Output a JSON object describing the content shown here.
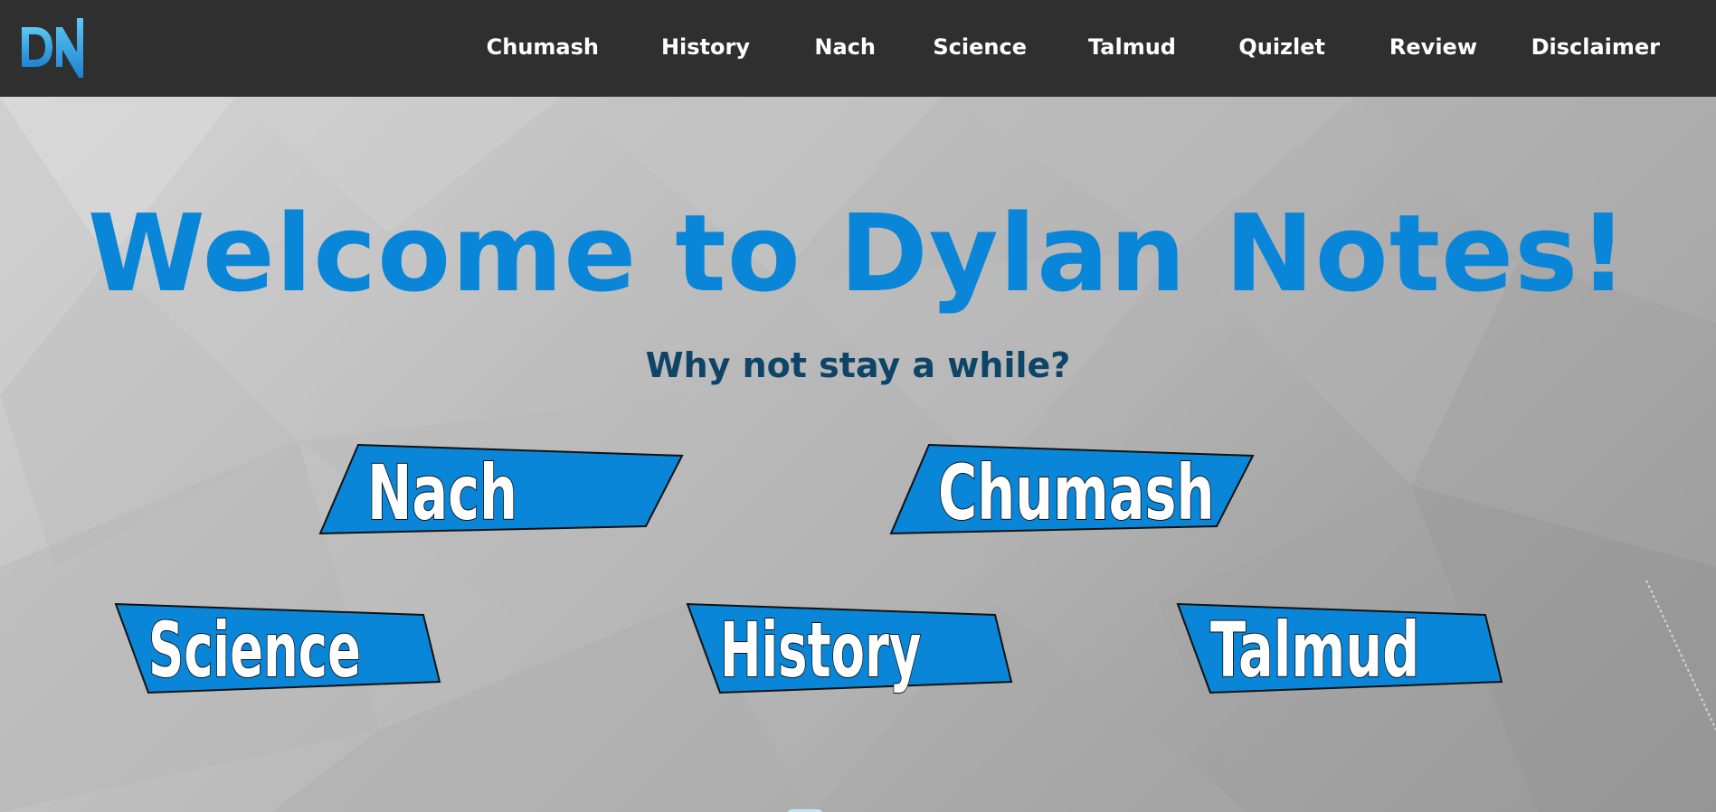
{
  "site": {
    "logo_text": "DN",
    "brand_color": "#0a86d8",
    "logo_color": "#3fb0e8"
  },
  "nav": {
    "items": [
      {
        "label": "Chumash"
      },
      {
        "label": "History"
      },
      {
        "label": "Nach"
      },
      {
        "label": "Science"
      },
      {
        "label": "Talmud"
      },
      {
        "label": "Quizlet"
      },
      {
        "label": "Review"
      },
      {
        "label": "Disclaimer"
      }
    ]
  },
  "hero": {
    "title": "Welcome to Dylan Notes!",
    "subtitle": "Why not stay a while?"
  },
  "tiles": [
    {
      "label": "Nach"
    },
    {
      "label": "Chumash"
    },
    {
      "label": "Science"
    },
    {
      "label": "History"
    },
    {
      "label": "Talmud"
    }
  ]
}
